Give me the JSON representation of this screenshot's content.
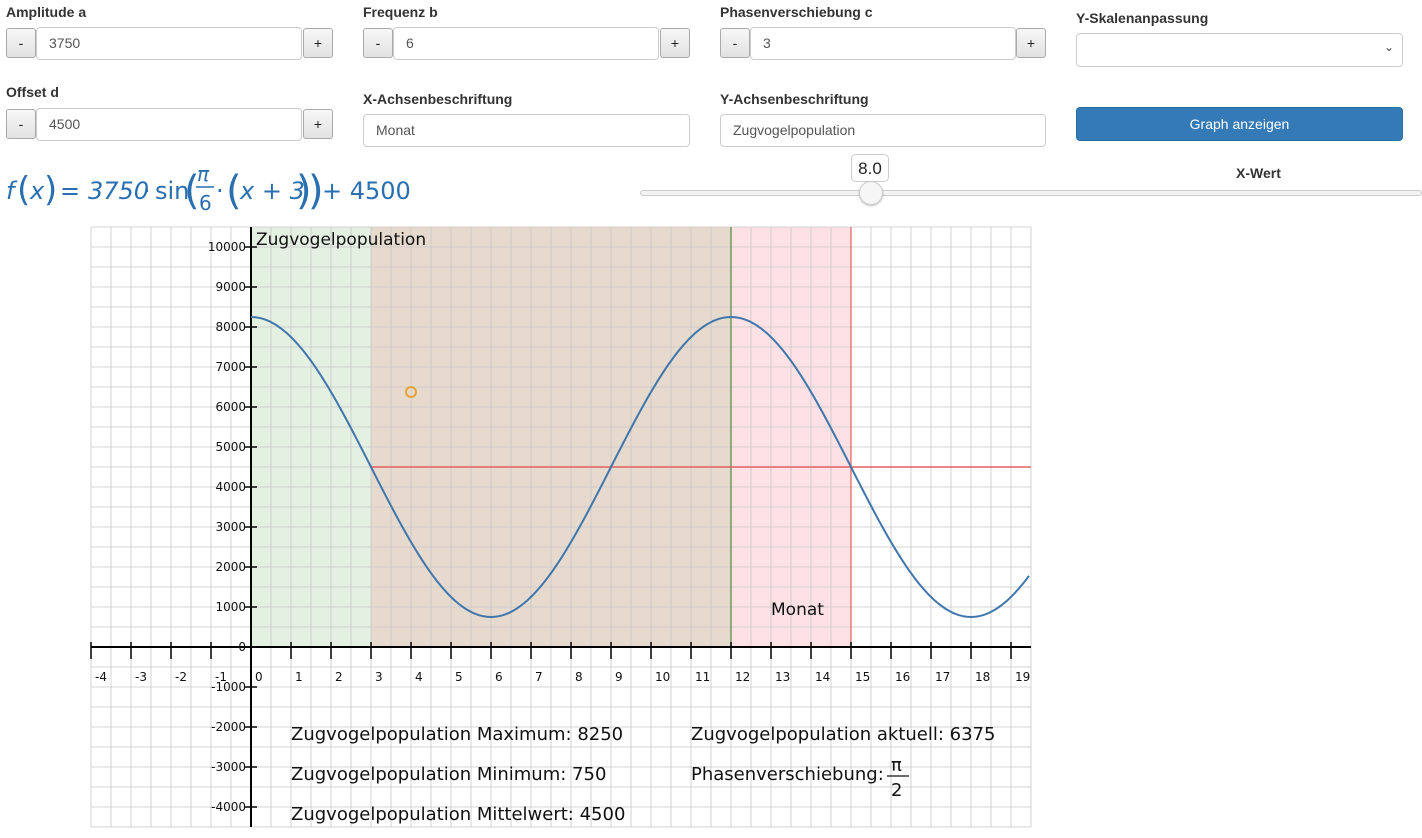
{
  "controls": {
    "amplitude": {
      "label": "Amplitude a",
      "value": "3750",
      "minus": "-",
      "plus": "+"
    },
    "frequency": {
      "label": "Frequenz b",
      "value": "6",
      "minus": "-",
      "plus": "+"
    },
    "phase": {
      "label": "Phasenverschiebung c",
      "value": "3",
      "minus": "-",
      "plus": "+"
    },
    "yscale": {
      "label": "Y-Skalenanpassung",
      "value": ""
    },
    "offset": {
      "label": "Offset d",
      "value": "4500",
      "minus": "-",
      "plus": "+"
    },
    "xaxis_label": {
      "label": "X-Achsenbeschriftung",
      "value": "Monat"
    },
    "yaxis_label": {
      "label": "Y-Achsenbeschriftung",
      "value": "Zugvogelpopulation"
    },
    "show_graph": "Graph anzeigen"
  },
  "formula": {
    "f": "f",
    "x": "x",
    "eq": "=",
    "amp": "3750",
    "dot": "·",
    "sin": "sin",
    "num": "π",
    "den": "6",
    "shift": "x + 3",
    "plus_offset": "+ 4500"
  },
  "slider": {
    "value": "8.0",
    "label": "X-Wert",
    "fraction": 0.299
  },
  "stats": {
    "max": "Zugvogelpopulation Maximum: 8250",
    "min": "Zugvogelpopulation Minimum: 750",
    "mean": "Zugvogelpopulation Mittelwert: 4500",
    "current": "Zugvogelpopulation aktuell: 6375",
    "phase_label": "Phasenverschiebung:",
    "phase_num": "π",
    "phase_den": "2"
  },
  "colors": {
    "curve": "#3f76ab",
    "marker": "#e8a33a",
    "midline": "#e06060",
    "green_zone": "#e4f0e2",
    "brown_zone": "#e6d9cd",
    "pink_zone": "#fde1e4",
    "primary": "#337ab7"
  },
  "chart_data": {
    "type": "line",
    "function": "3750*sin(pi/6*(x+3))+4500",
    "amplitude": 3750,
    "period": 12,
    "phase_shift": 3,
    "offset": 4500,
    "xlabel": "Monat",
    "ylabel": "Zugvogelpopulation",
    "xlim": [
      -4,
      19.3
    ],
    "ylim": [
      -4500,
      10500
    ],
    "x_ticks": [
      -4,
      -3,
      -2,
      -1,
      0,
      1,
      2,
      3,
      4,
      5,
      6,
      7,
      8,
      9,
      10,
      11,
      12,
      13,
      14,
      15,
      16,
      17,
      18,
      19
    ],
    "y_ticks": [
      -4000,
      -3000,
      -2000,
      -1000,
      0,
      1000,
      2000,
      3000,
      4000,
      5000,
      6000,
      7000,
      8000,
      9000,
      10000
    ],
    "highlight_point": {
      "x": 4,
      "y": 6375
    },
    "midline_y": 4500,
    "zones": [
      {
        "from": 0,
        "to": 3,
        "color": "green"
      },
      {
        "from": 3,
        "to": 12,
        "color": "brown"
      },
      {
        "from": 12,
        "to": 15,
        "color": "pink"
      }
    ],
    "vlines": [
      12,
      15
    ],
    "grid": true
  }
}
